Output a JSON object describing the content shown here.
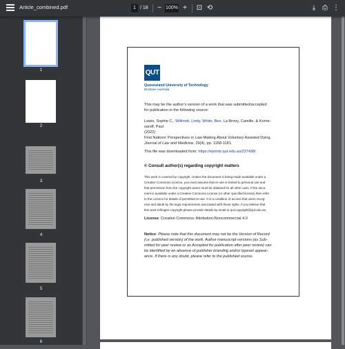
{
  "toolbar": {
    "filename": "Article_combined.pdf",
    "current_page": "1",
    "total_pages": "/ 18",
    "zoom_out": "−",
    "zoom_level": "100%",
    "zoom_in": "+",
    "fit_icon": "⊡",
    "rotate_icon": "⟲",
    "download_icon": "⤓",
    "print_icon": "⎙",
    "more_icon": "⋮"
  },
  "sidebar": {
    "thumbs": [
      {
        "label": "1"
      },
      {
        "label": "2"
      },
      {
        "label": "3"
      },
      {
        "label": "4"
      },
      {
        "label": "5"
      },
      {
        "label": "6"
      }
    ]
  },
  "doc": {
    "logo_text": "QUT",
    "university": "Queensland University of Technology",
    "city": "Brisbane Australia",
    "intro1": "This may be the author’s version of a work that was submitted/accepted",
    "intro2": "for publication in the following source:",
    "authors_a": "Lewis, Sophie C.,",
    "authors_b": "Willmott, Lindy,",
    "authors_c": "White, Ben,",
    "authors_d": "La Brooy, Camille, & Korne-",
    "authors_e": "sarolf, Paul",
    "year": "(2022)",
    "title": "First Nations’ Perspectives in Law-Making About Voluntary Assisted Dying.",
    "journal": "Journal of Law and Medicine",
    "journal_rest": ", 29(4), pp. 1168-1181.",
    "downloaded": "This file was downloaded from:",
    "url": "https://eprints.qut.edu.au/237438/",
    "copyright_heading": "© Consult author(s) regarding copyright matters",
    "c1": "This work is covered by copyright. Unless the document is being made available under a",
    "c2": "Creative Commons Licence, you must assume that re-use is limited to personal use and",
    "c3": "that permission from the copyright owner must be obtained for all other uses. If the docu-",
    "c4": "ment is available under a Creative Commons License (or other specified license) then refer",
    "c5": "to the Licence for details of permitted re-use. It is a condition of access that users recog-",
    "c6": "nise and abide by the legal requirements associated with these rights. If you believe that",
    "c7": "this work infringes copyright please provide details by email to qut.copyright@qut.edu.au",
    "license_label": "License",
    "license_value": ": Creative Commons: Attribution-Noncommercial 4.0",
    "notice_label": "Notice",
    "n1": ": Please note that this document may not be the Version of Record",
    "n2": "(i.e. published version) of the work. Author manuscript versions (as Sub-",
    "n3": "mitted for peer review or as Accepted for publication after peer review) can",
    "n4": "be identified by an absence of publisher branding and/or typeset appear-",
    "n5": "ance. If there is any doubt, please refer to the published source."
  },
  "colors": {
    "toolbar": "#323639",
    "background": "#525659",
    "qut_blue": "#0a4f8a",
    "link_blue": "#1a3aa8",
    "active_thumb_outline": "#8ab4f8"
  }
}
